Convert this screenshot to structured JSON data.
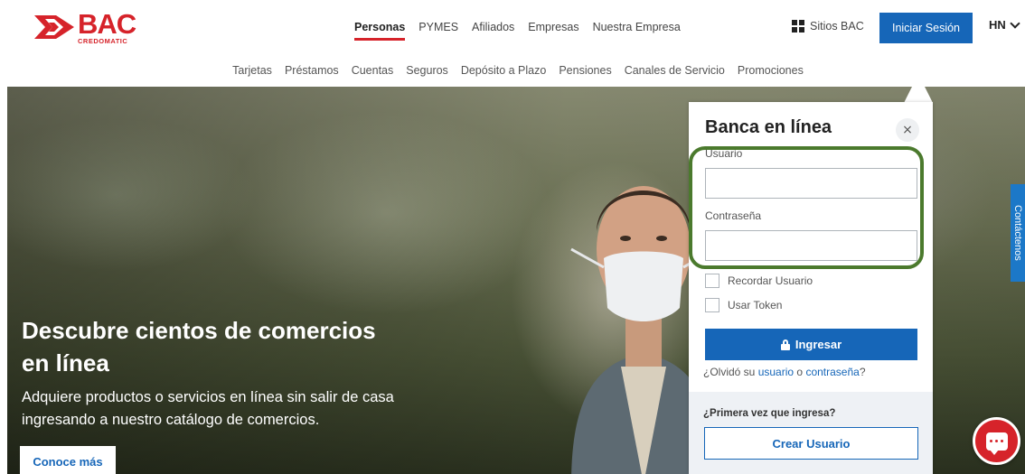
{
  "brand": {
    "name": "BAC",
    "subname": "CREDOMATIC",
    "color": "#d6232a"
  },
  "header": {
    "nav": [
      "Personas",
      "PYMES",
      "Afiliados",
      "Empresas",
      "Nuestra Empresa"
    ],
    "active_nav": "Personas",
    "sitios_label": "Sitios BAC",
    "login_label": "Iniciar Sesión",
    "country": "HN"
  },
  "subnav": [
    "Tarjetas",
    "Préstamos",
    "Cuentas",
    "Seguros",
    "Depósito a Plazo",
    "Pensiones",
    "Canales de Servicio",
    "Promociones"
  ],
  "hero": {
    "title": "Descubre cientos de comercios en línea",
    "text": "Adquiere productos o servicios en línea sin salir de casa ingresando a nuestro catálogo de comercios.",
    "cta": "Conoce más",
    "side_tab": "Contáctenos"
  },
  "login_panel": {
    "title": "Banca en línea",
    "close_symbol": "×",
    "username_label": "Usuario",
    "username_value": "",
    "password_label": "Contraseña",
    "password_value": "",
    "remember_label": "Recordar Usuario",
    "token_label": "Usar Token",
    "submit_label": "Ingresar",
    "forgot_prefix": "¿Olvidó su",
    "forgot_user": "usuario",
    "forgot_or": "o",
    "forgot_password": "contraseña",
    "forgot_suffix": "?",
    "first_time_label": "¿Primera vez que ingresa?",
    "create_user_label": "Crear Usuario"
  },
  "colors": {
    "primary": "#1666b8",
    "highlight": "#4b7a2d"
  }
}
